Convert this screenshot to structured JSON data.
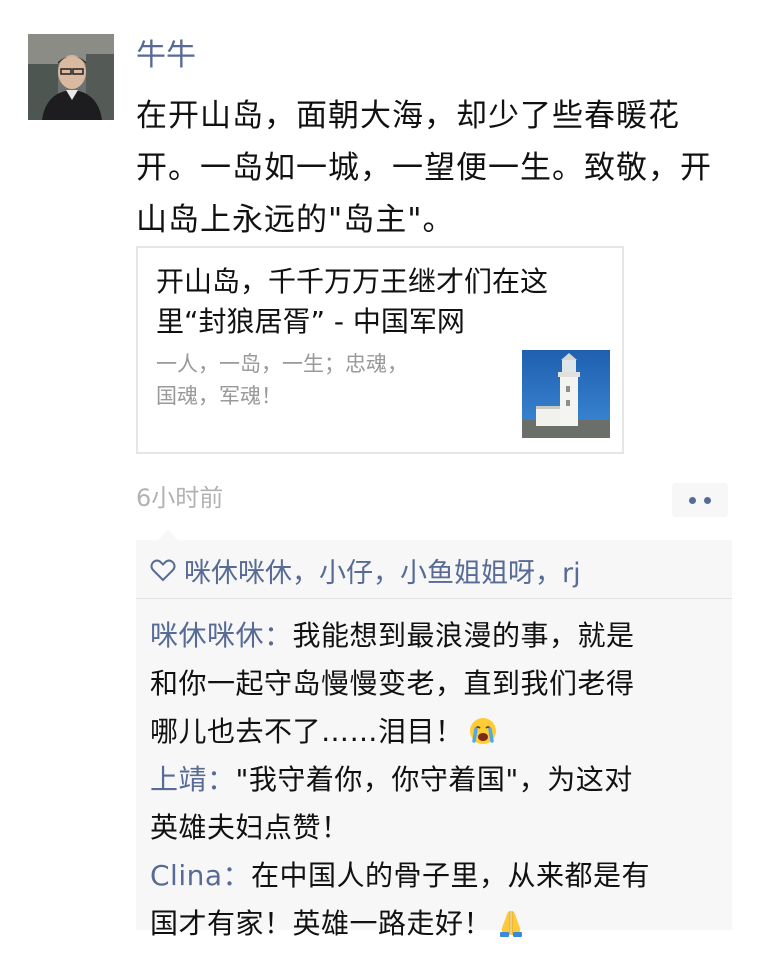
{
  "post": {
    "username": "牛牛",
    "text_lines": [
      "在开山岛，面朝大海，却少了些春暖花",
      "开。一岛如一城，一望便一生。致敬，开",
      "山岛上永远的\"岛主\"。"
    ],
    "link_card": {
      "title_lines": [
        "开山岛，千千万万王继才们在这",
        "里“封狼居胥” - 中国军网"
      ],
      "desc_lines": [
        "一人，一岛，一生；忠魂，",
        "国魂，军魂！"
      ],
      "thumbnail_icon": "lighthouse-thumbnail"
    },
    "timestamp": "6小时前",
    "more_icon": "more-dots-icon"
  },
  "likes": {
    "icon": "heart-outline-icon",
    "names": "咪休咪休，小仔，小鱼姐姐呀，rj"
  },
  "comments": [
    {
      "author": "咪休咪休",
      "separator": "：",
      "lines": [
        "我能想到最浪漫的事，就是",
        "和你一起守岛慢慢变老，直到我们老得",
        "哪儿也去不了……泪目！"
      ],
      "emoji": "crying-face-emoji"
    },
    {
      "author": "上靖",
      "separator": "：",
      "lines": [
        "\"我守着你，你守着国\"，为这对",
        "英雄夫妇点赞！"
      ],
      "emoji": ""
    },
    {
      "author": "Clina",
      "separator": "：",
      "lines": [
        "在中国人的骨子里，从来都是有",
        "国才有家！英雄一路走好！"
      ],
      "emoji": "folded-hands-emoji"
    }
  ],
  "colors": {
    "name_blue": "#576b95",
    "timestamp_gray": "#b2b2b2",
    "comment_bg": "#f7f7f7"
  }
}
